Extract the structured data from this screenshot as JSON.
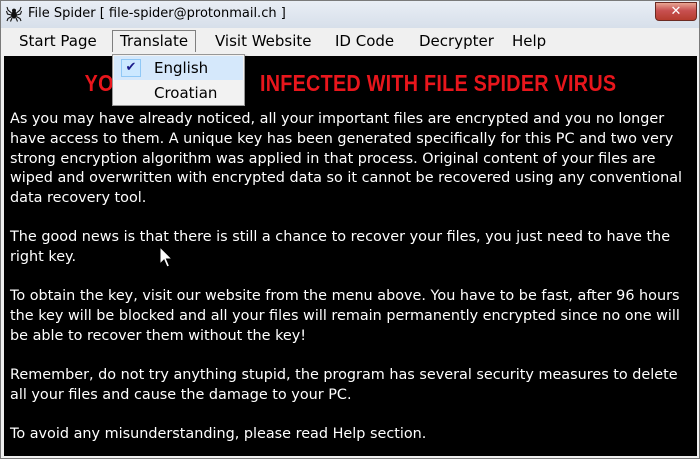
{
  "window": {
    "title": "File Spider [ file-spider@protonmail.ch ]",
    "close_glyph": "✕"
  },
  "menu": {
    "items": [
      {
        "label": "Start Page"
      },
      {
        "label": "Translate"
      },
      {
        "label": "Visit Website"
      },
      {
        "label": "ID Code"
      },
      {
        "label": "Decrypter"
      },
      {
        "label": "Help"
      }
    ]
  },
  "translate_menu": {
    "options": [
      {
        "label": "English",
        "checked": true
      },
      {
        "label": "Croatian",
        "checked": false
      }
    ],
    "check_glyph": "✔"
  },
  "content": {
    "banner_visible": "INFECTED WITH FILE SPIDER VIRUS",
    "banner_prefix_visible": "YO",
    "paragraphs": [
      "As you may have already noticed, all your important files are encrypted and you no longer have access to them. A unique key has been generated specifically for this PC and two very strong encryption algorithm was applied in that process. Original content of your files are wiped and overwritten with encrypted data so it cannot be recovered using any conventional data recovery tool.",
      "The good news is that there is still a chance to recover your files, you just need to have the right key.",
      "To obtain the key, visit our website from the menu above. You have to be fast, after 96 hours the key will be blocked and all your files will remain permanently encrypted since no one will be able to recover them without the key!",
      "Remember, do not try anything stupid, the program has several security measures to delete all your files and cause the damage to your PC.",
      "To avoid any misunderstanding, please read Help section."
    ]
  },
  "colors": {
    "banner": "#e8161c",
    "content_bg": "#000000",
    "content_text": "#ffffff",
    "close_button": "#c75050"
  },
  "icons": {
    "app": "spider-icon",
    "close": "close-icon",
    "check": "checkmark-icon",
    "cursor": "mouse-pointer-icon"
  }
}
